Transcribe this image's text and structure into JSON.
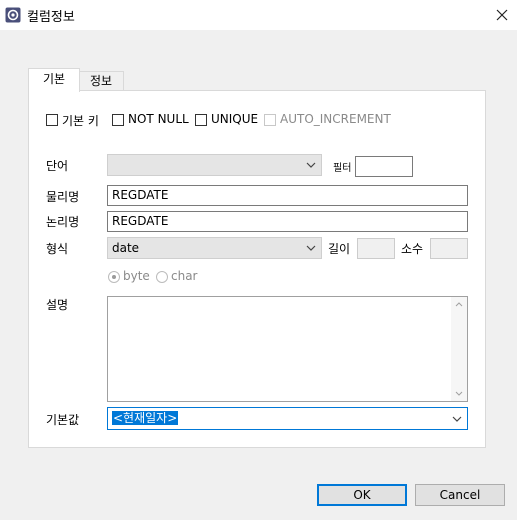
{
  "window": {
    "title": "컬럼정보",
    "icon": "gear-icon"
  },
  "tabs": [
    {
      "label": "기본",
      "active": true
    },
    {
      "label": "정보",
      "active": false
    }
  ],
  "options": {
    "primary_key": {
      "label": "기본 키",
      "checked": false
    },
    "not_null": {
      "label": "NOT NULL",
      "checked": false
    },
    "unique": {
      "label": "UNIQUE",
      "checked": false
    },
    "auto_increment": {
      "label": "AUTO_INCREMENT",
      "checked": false,
      "disabled": true
    }
  },
  "form": {
    "word_label": "단어",
    "word_value": "",
    "filter_label": "필터",
    "filter_value": "",
    "physical_name_label": "물리명",
    "physical_name_value": "REGDATE",
    "logical_name_label": "논리명",
    "logical_name_value": "REGDATE",
    "type_label": "형식",
    "type_value": "date",
    "length_label": "길이",
    "length_value": "",
    "decimal_label": "소수",
    "decimal_value": "",
    "unit_byte": "byte",
    "unit_char": "char",
    "unit_selected": "byte",
    "description_label": "설명",
    "description_value": "",
    "default_label": "기본값",
    "default_value": "<현재일자>"
  },
  "buttons": {
    "ok": "OK",
    "cancel": "Cancel"
  },
  "colors": {
    "accent": "#0078d7",
    "panel": "#ffffff",
    "background": "#f0f0f0"
  }
}
